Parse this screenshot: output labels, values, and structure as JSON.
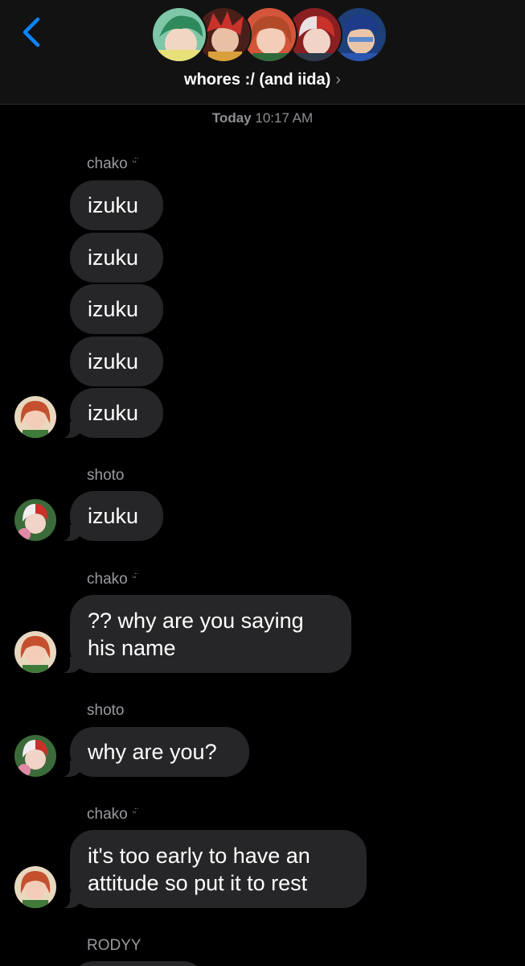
{
  "header": {
    "back_icon": "chevron-left-icon",
    "group_title": "whores :/ (and iida)",
    "title_chevron": "›",
    "avatars": [
      {
        "name": "izuku",
        "bg": "#7fc7a8",
        "hair": "#2e8a5c",
        "skin": "#f1d7c3"
      },
      {
        "name": "kirishima",
        "bg": "#4a1f1a",
        "hair": "#c8322a",
        "skin": "#e8c0a6"
      },
      {
        "name": "chako",
        "bg": "#d4553a",
        "hair": "#b24a2a",
        "skin": "#f3cdb8"
      },
      {
        "name": "shoto",
        "bg": "#8a1f22",
        "hair": "#e9e1e3",
        "skin": "#f1d4c7"
      },
      {
        "name": "iida",
        "bg": "#1d3f7a",
        "hair": "#1e3b8a",
        "skin": "#eac6a9"
      }
    ]
  },
  "timestamp": {
    "day": "Today",
    "time": "10:17 AM"
  },
  "messages": {
    "g1_sender": "chako",
    "g1_m1": "izuku",
    "g1_m2": "izuku",
    "g1_m3": "izuku",
    "g1_m4": "izuku",
    "g1_m5": "izuku",
    "g2_sender": "shoto",
    "g2_m1": "izuku",
    "g3_sender": "chako",
    "g3_m1": "?? why are you saying\nhis name",
    "g4_sender": "shoto",
    "g4_m1": "why are you?",
    "g5_sender": "chako",
    "g5_m1": "it's too early to have an\nattitude so put it to rest",
    "g6_sender": "RODYY"
  },
  "mute_icon": "bell-slash-icon",
  "colors": {
    "background": "#000000",
    "header": "#121212",
    "bubble": "#262628",
    "accent": "#0a84ff",
    "secondary_text": "#8e8e93"
  }
}
